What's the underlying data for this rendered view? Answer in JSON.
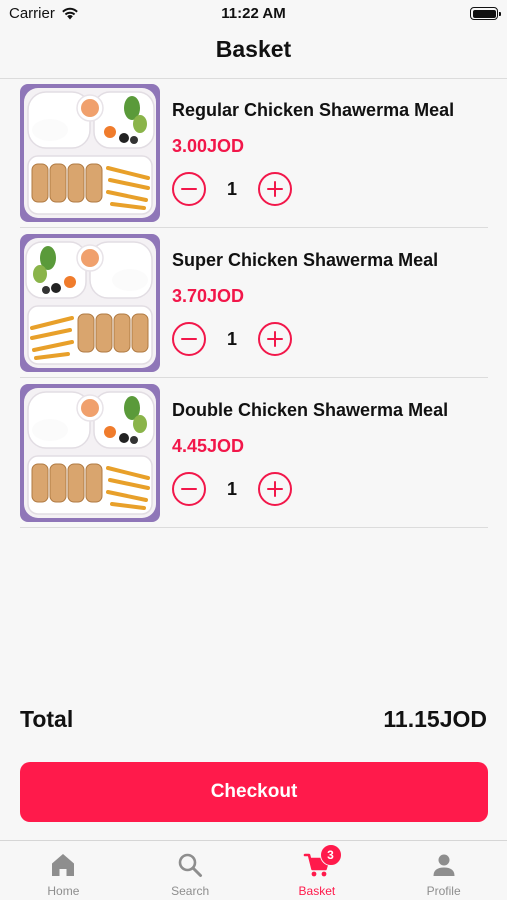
{
  "status_bar": {
    "carrier": "Carrier",
    "time": "11:22 AM"
  },
  "header": {
    "title": "Basket"
  },
  "basket": {
    "items": [
      {
        "name": "Regular Chicken Shawerma Meal",
        "price": "3.00JOD",
        "quantity": "1"
      },
      {
        "name": "Super Chicken Shawerma Meal",
        "price": "3.70JOD",
        "quantity": "1"
      },
      {
        "name": "Double Chicken Shawerma Meal",
        "price": "4.45JOD",
        "quantity": "1"
      }
    ],
    "total_label": "Total",
    "total_value": "11.15JOD",
    "checkout_label": "Checkout"
  },
  "tabbar": {
    "tabs": [
      {
        "label": "Home",
        "icon": "home-icon",
        "active": false
      },
      {
        "label": "Search",
        "icon": "search-icon",
        "active": false
      },
      {
        "label": "Basket",
        "icon": "cart-icon",
        "active": true,
        "badge": "3"
      },
      {
        "label": "Profile",
        "icon": "person-icon",
        "active": false
      }
    ]
  },
  "colors": {
    "accent": "#ff1a4b",
    "price": "#f2174a",
    "inactive": "#8e8e8e",
    "background": "#f7f7f7"
  }
}
